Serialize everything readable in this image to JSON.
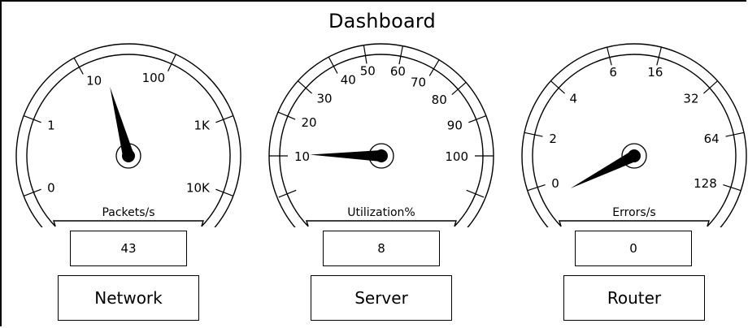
{
  "title": "Dashboard",
  "gauges": [
    {
      "id": "network",
      "unit_label": "Packets/s",
      "readout": "43",
      "name": "Network",
      "scale_labels": [
        "0",
        "1",
        "10",
        "100",
        "1K",
        "10K"
      ],
      "value": 43,
      "scale": "log10"
    },
    {
      "id": "server",
      "unit_label": "Utilization%",
      "readout": "8",
      "name": "Server",
      "scale_labels": [
        "10",
        "20",
        "30",
        "40",
        "50",
        "60",
        "70",
        "80",
        "90",
        "100"
      ],
      "value": 8,
      "scale": "linear"
    },
    {
      "id": "router",
      "unit_label": "Errors/s",
      "readout": "0",
      "name": "Router",
      "scale_labels": [
        "0",
        "2",
        "4",
        "6",
        "16",
        "32",
        "64",
        "128"
      ],
      "value": 0,
      "scale": "log2"
    }
  ]
}
